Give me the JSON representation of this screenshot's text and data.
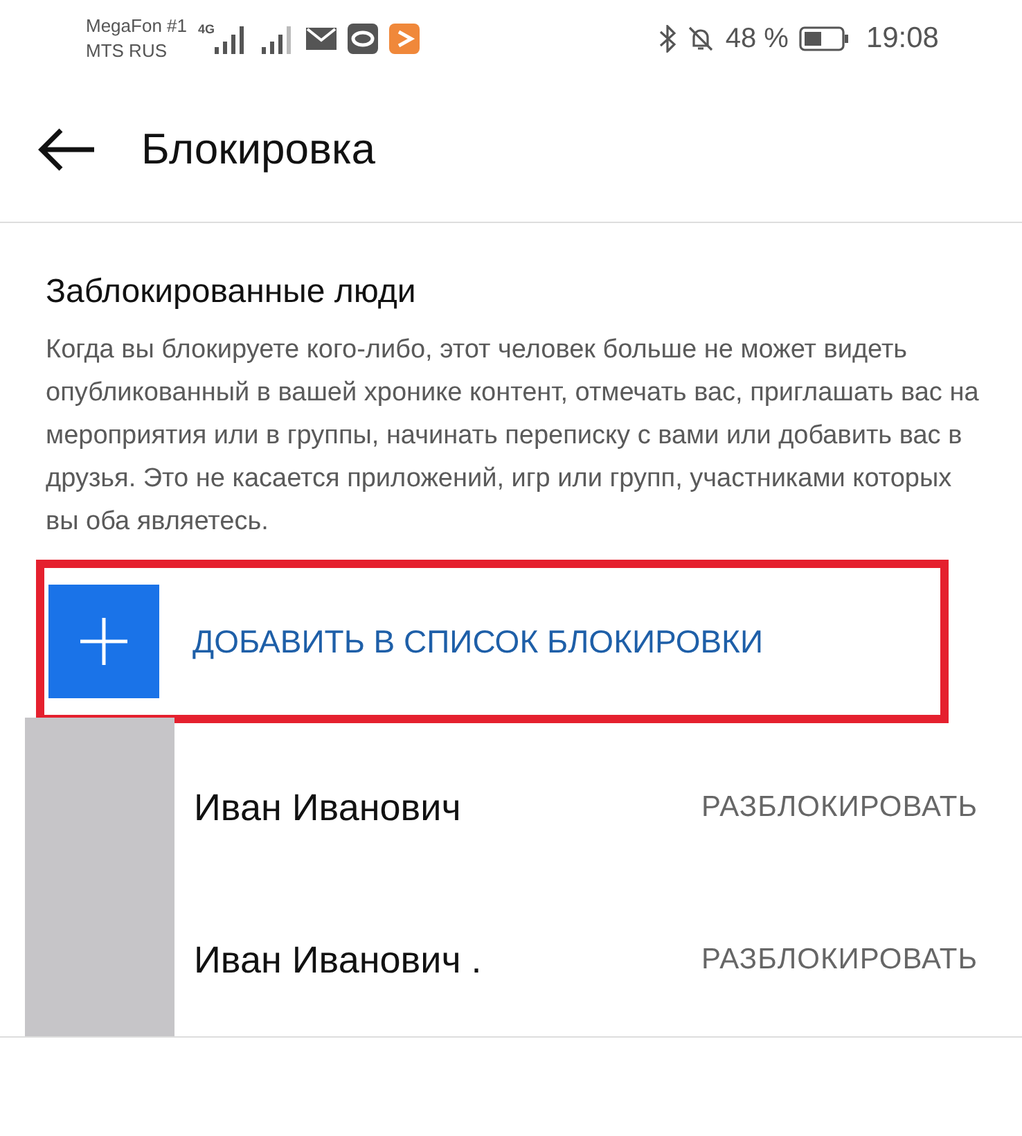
{
  "status_bar": {
    "carrier_1": "MegaFon #1",
    "carrier_2": "MTS RUS",
    "network": "4G",
    "battery": "48 %",
    "time": "19:08"
  },
  "header": {
    "title": "Блокировка"
  },
  "section": {
    "title": "Заблокированные люди",
    "description": "Когда вы блокируете кого-либо, этот человек больше не может видеть опубликованный в вашей хронике контент, отмечать вас, приглашать вас на мероприятия или в группы, начинать переписку с вами или добавить вас в друзья. Это не касается приложений, игр или групп, участниками которых вы оба являетесь."
  },
  "add_button": {
    "label": "ДОБАВИТЬ В СПИСОК БЛОКИРОВКИ",
    "highlighted": true
  },
  "blocked": [
    {
      "name": "Иван Иванович",
      "action": "РАЗБЛОКИРОВАТЬ"
    },
    {
      "name": "Иван Иванович .",
      "action": "РАЗБЛОКИРОВАТЬ"
    }
  ]
}
